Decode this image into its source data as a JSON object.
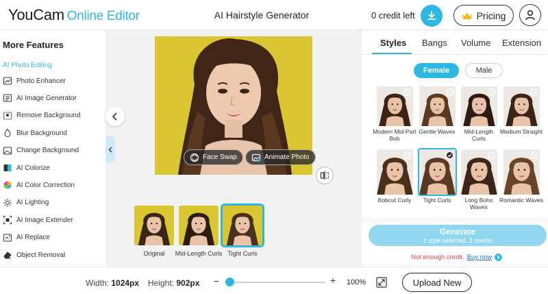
{
  "header": {
    "logo_brand": "YouCam",
    "logo_suffix": "Online Editor",
    "title": "AI Hairstyle Generator",
    "credits": "0 credit left",
    "pricing_label": "Pricing"
  },
  "sidebar": {
    "title": "More Features",
    "section": "AI Photo Editing",
    "items": [
      {
        "label": "Photo Enhancer",
        "icon": "photo-enhancer-icon"
      },
      {
        "label": "AI Image Generator",
        "icon": "image-generator-icon"
      },
      {
        "label": "Remove Background",
        "icon": "remove-background-icon"
      },
      {
        "label": "Blur Background",
        "icon": "blur-background-icon"
      },
      {
        "label": "Change Background",
        "icon": "change-background-icon"
      },
      {
        "label": "AI Colorize",
        "icon": "colorize-icon"
      },
      {
        "label": "AI Color Correction",
        "icon": "color-correction-icon"
      },
      {
        "label": "AI Lighting",
        "icon": "lighting-icon"
      },
      {
        "label": "AI Image Extender",
        "icon": "image-extender-icon"
      },
      {
        "label": "AI Replace",
        "icon": "replace-icon"
      },
      {
        "label": "Object Removal",
        "icon": "eraser-icon"
      }
    ]
  },
  "canvas": {
    "face_swap_label": "Face Swap",
    "animate_label": "Animate Photo",
    "thumbnails": [
      {
        "label": "Original",
        "hair": "#3a2618"
      },
      {
        "label": "Mid-Length Curls",
        "hair": "#2c1c12"
      },
      {
        "label": "Tight Curls",
        "hair": "#4a3020"
      }
    ]
  },
  "panel": {
    "tabs": [
      "Styles",
      "Bangs",
      "Volume",
      "Extension"
    ],
    "active_tab": "Styles",
    "gender": {
      "female": "Female",
      "male": "Male",
      "selected": "Female"
    },
    "styles": [
      {
        "label": "Modern Mid-Part Bob",
        "hair": "#3b2415",
        "selected": false
      },
      {
        "label": "Gentle Waves",
        "hair": "#5a3a22",
        "selected": false
      },
      {
        "label": "Mid-Length Curls",
        "hair": "#2e1b10",
        "selected": false
      },
      {
        "label": "Medium Straight",
        "hair": "#3a2517",
        "selected": false
      },
      {
        "label": "Bobcut Curly",
        "hair": "#4a2f1c",
        "selected": false
      },
      {
        "label": "Tight Curls",
        "hair": "#5b3a22",
        "selected": true
      },
      {
        "label": "Long Boho Waves",
        "hair": "#3d2617",
        "selected": false
      },
      {
        "label": "Romantic Waves",
        "hair": "#6a4427",
        "selected": false
      }
    ],
    "generate_label": "Generate",
    "generate_sub": "1 style selected, 2 credits",
    "credit_warning": "Not enough credit.",
    "buy_now": "Buy now"
  },
  "bottom": {
    "width_label": "Width:",
    "width_value": "1024px",
    "height_label": "Height:",
    "height_value": "902px",
    "zoom_minus": "−",
    "zoom_plus": "+",
    "zoom_level": "100%",
    "upload_label": "Upload New"
  },
  "colors": {
    "accent": "#2db8e1",
    "photo_background": "#d9c630",
    "warning": "#e23b4b",
    "skin": "#e9c3a8"
  }
}
